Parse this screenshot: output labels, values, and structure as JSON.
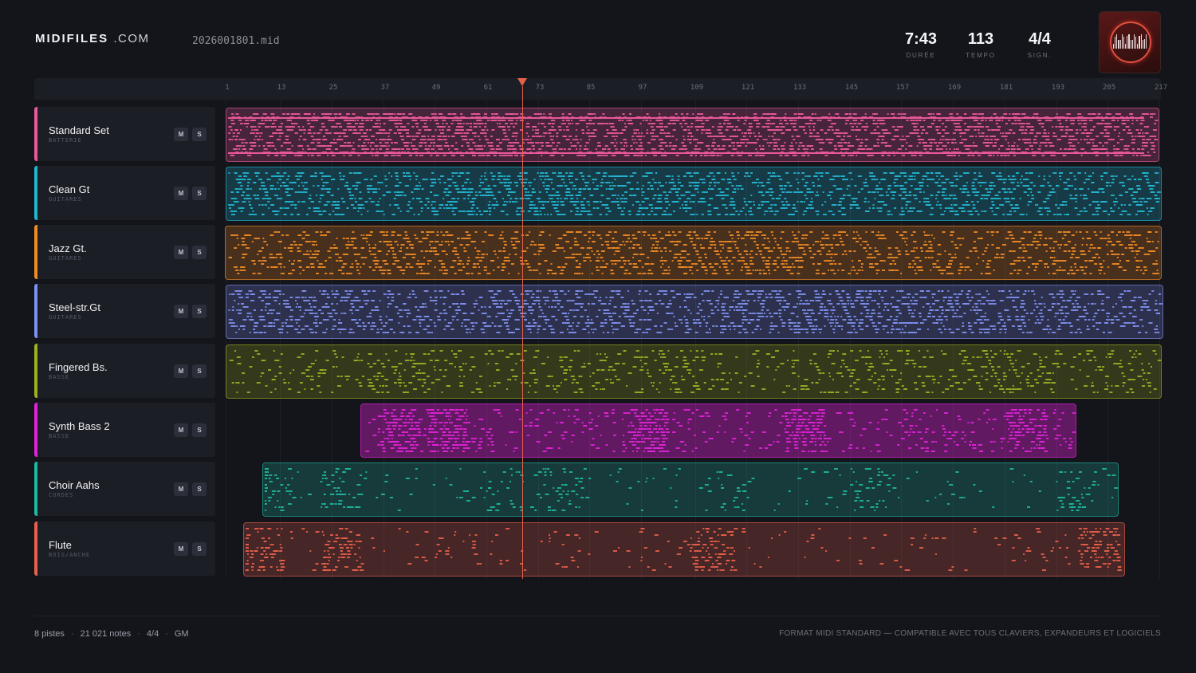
{
  "header": {
    "brand_bold": "MIDIFILES",
    "brand_rest": ".COM",
    "filename": "2026001801.mid",
    "stats": [
      {
        "value": "7:43",
        "label": "DURÉE"
      },
      {
        "value": "113",
        "label": "TEMPO"
      },
      {
        "value": "4/4",
        "label": "SIGN."
      }
    ]
  },
  "ruler": {
    "ticks": [
      "1",
      "13",
      "25",
      "37",
      "49",
      "61",
      "73",
      "85",
      "97",
      "109",
      "121",
      "133",
      "145",
      "157",
      "169",
      "181",
      "193",
      "205",
      "217"
    ]
  },
  "tracks": [
    {
      "name": "Standard Set",
      "category": "BATTERIE",
      "color": "#e8589a",
      "mute": "M",
      "solo": "S"
    },
    {
      "name": "Clean Gt",
      "category": "GUITARES",
      "color": "#22b6d2",
      "mute": "M",
      "solo": "S"
    },
    {
      "name": "Jazz Gt.",
      "category": "GUITARES",
      "color": "#f08a24",
      "mute": "M",
      "solo": "S"
    },
    {
      "name": "Steel-str.Gt",
      "category": "GUITARES",
      "color": "#7e90f0",
      "mute": "M",
      "solo": "S"
    },
    {
      "name": "Fingered Bs.",
      "category": "BASSE",
      "color": "#9bb022",
      "mute": "M",
      "solo": "S"
    },
    {
      "name": "Synth Bass 2",
      "category": "BASSE",
      "color": "#e022d8",
      "mute": "M",
      "solo": "S"
    },
    {
      "name": "Choir Aahs",
      "category": "CORDES",
      "color": "#1fb8a0",
      "mute": "M",
      "solo": "S"
    },
    {
      "name": "Flute",
      "category": "BOIS/ANCHE",
      "color": "#e8604a",
      "mute": "M",
      "solo": "S"
    }
  ],
  "footer": {
    "tracks_count": "8 pistes",
    "notes_count": "21 021 notes",
    "signature": "4/4",
    "standard": "GM",
    "tagline": "FORMAT MIDI STANDARD — COMPATIBLE AVEC TOUS CLAVIERS, EXPANDEURS ET LOGICIELS"
  }
}
